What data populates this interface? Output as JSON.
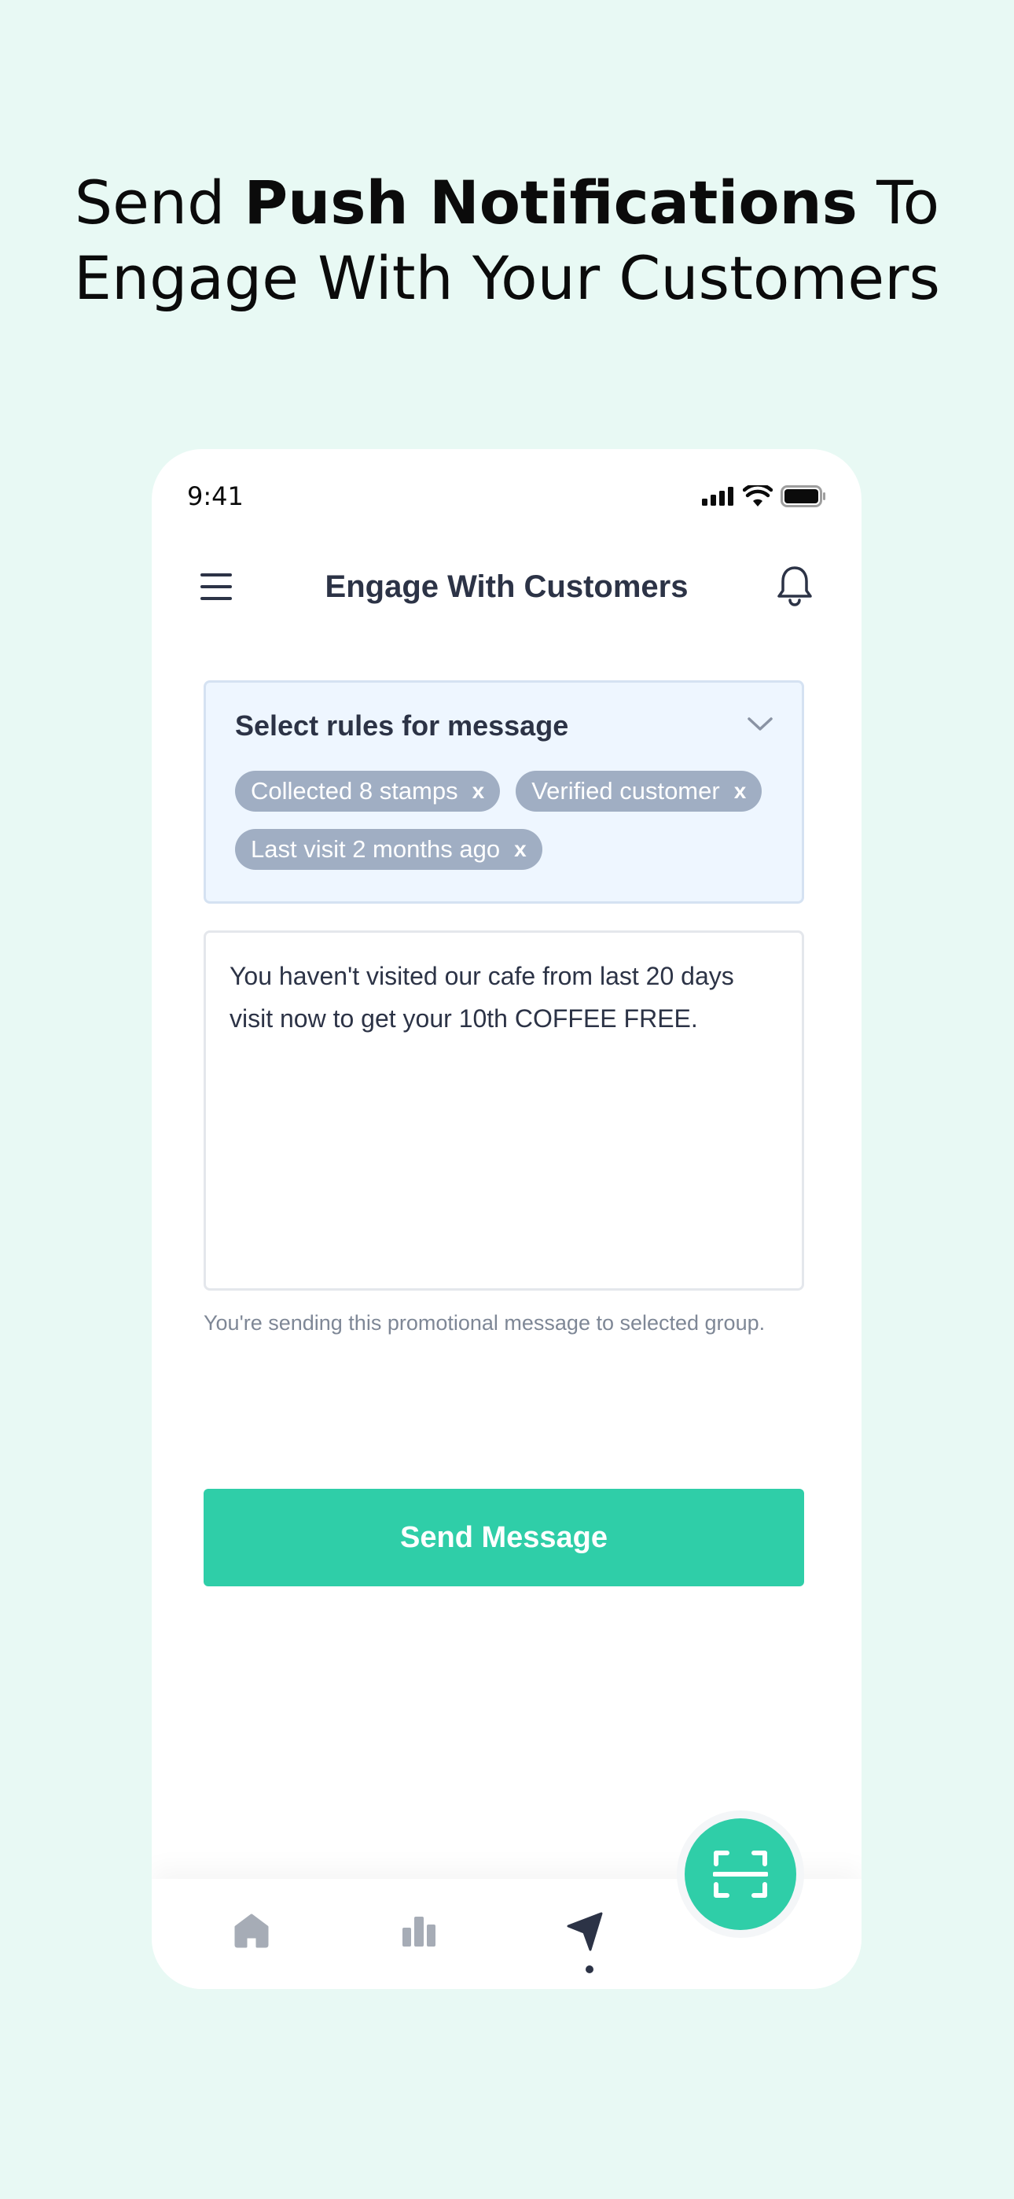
{
  "headline": {
    "prefix": "Send ",
    "bold": "Push Notifications",
    "suffix": " To",
    "line2": "Engage With Your Customers"
  },
  "status_bar": {
    "time": "9:41"
  },
  "header": {
    "title": "Engage With Customers",
    "menu_icon": "hamburger-menu-icon",
    "notification_icon": "bell-icon"
  },
  "rules": {
    "title": "Select rules for message",
    "chips": [
      {
        "label": "Collected 8 stamps",
        "remove": "x"
      },
      {
        "label": "Verified customer",
        "remove": "x"
      },
      {
        "label": "Last visit 2 months ago",
        "remove": "x"
      }
    ]
  },
  "message": {
    "value": "You haven't visited our cafe from last 20 days visit now to get your 10th COFFEE FREE.",
    "hint": "You're sending this promotional message to selected group."
  },
  "send_button": {
    "label": "Send Message"
  },
  "tab_bar": {
    "items": [
      {
        "icon": "home-icon",
        "active": false
      },
      {
        "icon": "bar-chart-icon",
        "active": false
      },
      {
        "icon": "send-arrow-icon",
        "active": true
      }
    ],
    "fab_icon": "scan-icon"
  },
  "colors": {
    "background": "#E8F9F4",
    "accent": "#2FCEA8",
    "chip": "#A0AEC3",
    "text": "#2C3346"
  }
}
